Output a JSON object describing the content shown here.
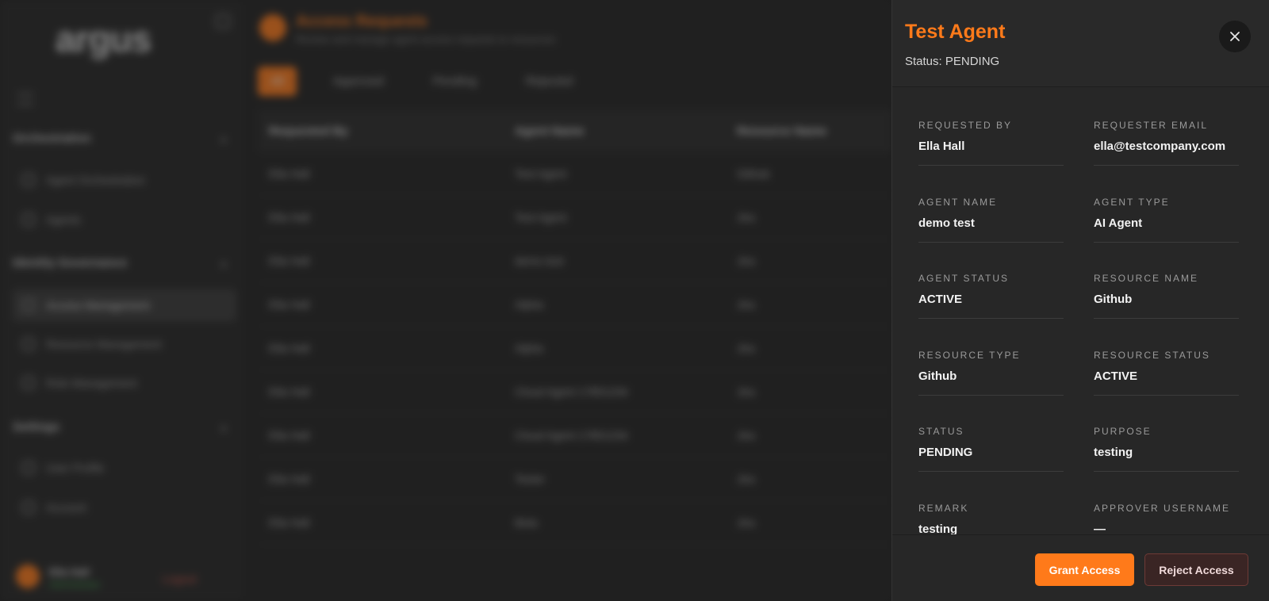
{
  "background": {
    "logo": "argus",
    "page": {
      "title": "Access Requests",
      "subtitle": "Review and manage agent access requests to resources"
    },
    "sidebar": {
      "sections": [
        {
          "label": "Orchestration",
          "items": [
            "Agent Orchestration",
            "Agents"
          ]
        },
        {
          "label": "Identity Governance",
          "items": [
            "Access Management",
            "Resource Management",
            "Role Management"
          ]
        },
        {
          "label": "Settings",
          "items": [
            "User Profile",
            "Account"
          ]
        }
      ],
      "user": {
        "name": "Ella Hall",
        "role": "Administrator",
        "logout": "Logout"
      }
    },
    "tabs": [
      "All",
      "Approved",
      "Pending",
      "Rejected"
    ],
    "table": {
      "headers": [
        "Requested By",
        "Agent Name",
        "Resource Name"
      ],
      "rows": [
        [
          "Ella Hall",
          "Test Agent",
          "Github"
        ],
        [
          "Ella Hall",
          "Test Agent",
          "Jira"
        ],
        [
          "Ella Hall",
          "demo test",
          "Jira"
        ],
        [
          "Ella Hall",
          "Alpha",
          "Jira"
        ],
        [
          "Ella Hall",
          "Alpha",
          "Jira"
        ],
        [
          "Ella Hall",
          "Cloud Agent 17851234",
          "Jira"
        ],
        [
          "Ella Hall",
          "Cloud Agent 17851234",
          "Jira"
        ],
        [
          "Ella Hall",
          "Tester",
          "Jira"
        ],
        [
          "Ella Hall",
          "Beta",
          "Jira"
        ]
      ]
    }
  },
  "drawer": {
    "title": "Test Agent",
    "status_line": "Status: PENDING",
    "fields": [
      {
        "label": "REQUESTED BY",
        "value": "Ella Hall"
      },
      {
        "label": "REQUESTER EMAIL",
        "value": "ella@testcompany.com"
      },
      {
        "label": "AGENT NAME",
        "value": "demo test"
      },
      {
        "label": "AGENT TYPE",
        "value": "AI Agent"
      },
      {
        "label": "AGENT STATUS",
        "value": "ACTIVE"
      },
      {
        "label": "RESOURCE NAME",
        "value": "Github"
      },
      {
        "label": "RESOURCE TYPE",
        "value": "Github"
      },
      {
        "label": "RESOURCE STATUS",
        "value": "ACTIVE"
      },
      {
        "label": "STATUS",
        "value": "PENDING"
      },
      {
        "label": "PURPOSE",
        "value": "testing"
      },
      {
        "label": "REMARK",
        "value": "testing"
      },
      {
        "label": "APPROVER USERNAME",
        "value": "—"
      }
    ],
    "actions": {
      "grant": "Grant Access",
      "reject": "Reject Access"
    }
  },
  "colors": {
    "accent": "#ff7a1a",
    "drawer_bg": "#272727",
    "reject_bg": "#3a2524"
  }
}
